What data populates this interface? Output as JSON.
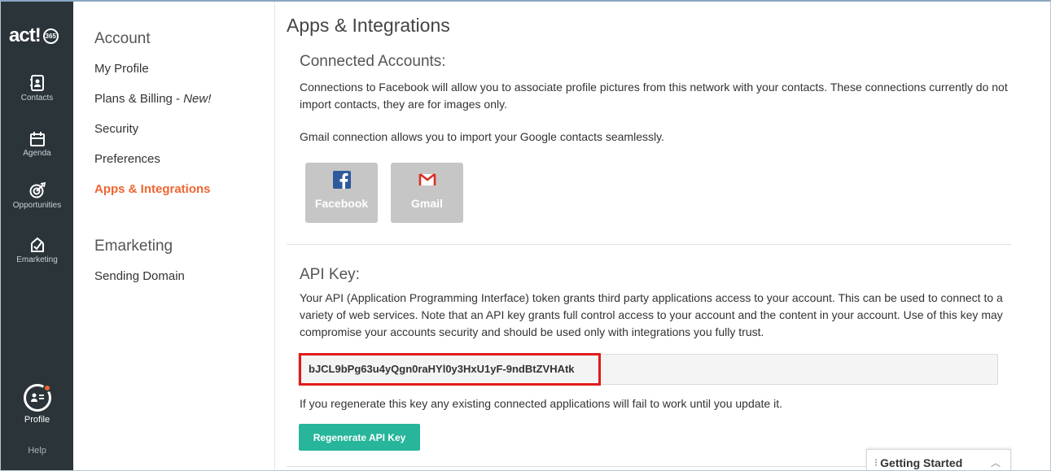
{
  "app": {
    "logo_text": "act!",
    "logo_badge": "365"
  },
  "rail": {
    "items": [
      {
        "label": "Contacts",
        "icon": "contacts-icon"
      },
      {
        "label": "Agenda",
        "icon": "calendar-icon"
      },
      {
        "label": "Opportunities",
        "icon": "target-icon"
      },
      {
        "label": "Emarketing",
        "icon": "emarketing-icon"
      }
    ],
    "profile_label": "Profile",
    "help_label": "Help"
  },
  "nav": {
    "account_heading": "Account",
    "account_items": {
      "my_profile": "My Profile",
      "plans_billing": "Plans & Billing - ",
      "plans_billing_new": "New!",
      "security": "Security",
      "preferences": "Preferences",
      "apps_integrations": "Apps & Integrations"
    },
    "emarketing_heading": "Emarketing",
    "emarketing_items": {
      "sending_domain": "Sending Domain"
    }
  },
  "main": {
    "title": "Apps & Integrations",
    "connected": {
      "title": "Connected Accounts:",
      "desc1": "Connections to Facebook will allow you to associate profile pictures from this network with your contacts. These connections currently do not import contacts, they are for images only.",
      "desc2": "Gmail connection allows you to import your Google contacts seamlessly.",
      "facebook_label": "Facebook",
      "gmail_label": "Gmail"
    },
    "api": {
      "title": "API Key:",
      "desc": "Your API (Application Programming Interface) token grants third party applications access to your account. This can be used to connect to a variety of web services. Note that an API key grants full control access to your account and the content in your account. Use of this key may compromise your accounts security and should be used only with integrations you fully trust.",
      "key_value": "bJCL9bPg63u4yQgn0raHYl0y3HxU1yF-9ndBtZVHAtk",
      "warning": "If you regenerate this key any existing connected applications will fail to work until you update it.",
      "regenerate_label": "Regenerate API Key"
    }
  },
  "getting_started": {
    "label": "Getting Started"
  },
  "colors": {
    "rail_bg": "#2b3439",
    "accent_orange": "#f0652f",
    "button_teal": "#27b59b",
    "highlight_red": "#e21a1a"
  }
}
